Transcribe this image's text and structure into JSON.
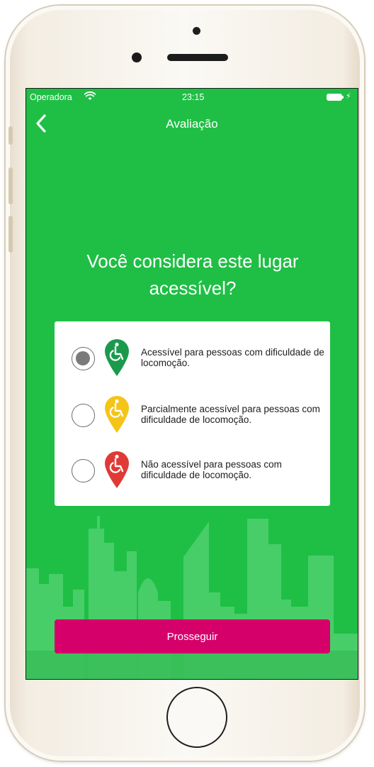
{
  "statusbar": {
    "carrier": "Operadora",
    "time": "23:15"
  },
  "navbar": {
    "title": "Avaliação",
    "back_icon": "chevron-left-icon"
  },
  "question": "Você considera este lugar acessível?",
  "options": [
    {
      "label": "Acessível para pessoas com dificuldade de locomoção.",
      "color": "#1b9a4c",
      "selected": true,
      "icon": "wheelchair-pin-icon"
    },
    {
      "label": "Parcialmente acessível para pessoas com dificuldade de locomoção.",
      "color": "#f4c417",
      "selected": false,
      "icon": "wheelchair-pin-icon"
    },
    {
      "label": "Não acessível para pessoas com dificuldade de locomoção.",
      "color": "#e03a36",
      "selected": false,
      "icon": "wheelchair-pin-icon"
    }
  ],
  "continue_button": "Prosseguir",
  "colors": {
    "background": "#1fbf45",
    "button": "#d6006a"
  }
}
